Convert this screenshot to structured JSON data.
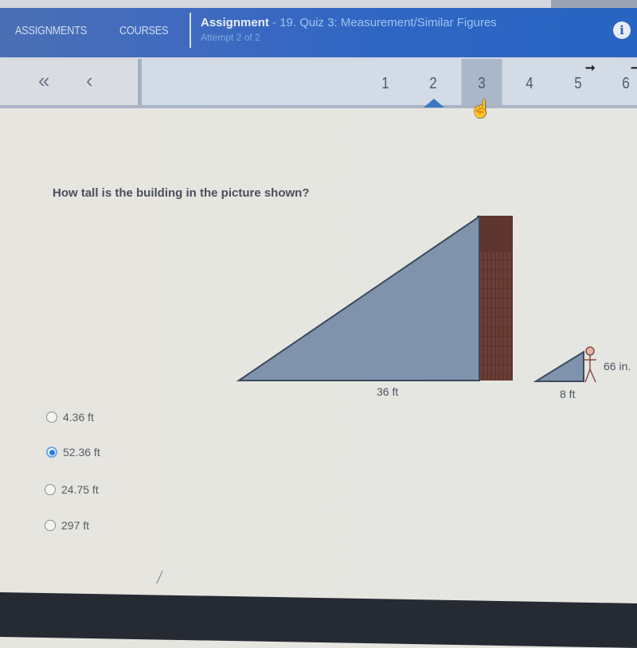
{
  "header": {
    "nav": [
      {
        "label": "ASSIGNMENTS"
      },
      {
        "label": "COURSES"
      }
    ],
    "title_strong": "Assignment",
    "title_rest": "  - 19. Quiz 3: Measurement/Similar Figures",
    "attempt": "Attempt 2 of 2",
    "info_glyph": "i"
  },
  "pager": {
    "first_glyph": "«",
    "prev_glyph": "‹",
    "pages": [
      "1",
      "2",
      "3",
      "4",
      "5",
      "6"
    ],
    "current_page": "2",
    "hovered_page": "3",
    "flag_glyph": "➞"
  },
  "question": {
    "text": "How tall is the building in the picture shown?",
    "diagram": {
      "building_shadow_label": "36 ft",
      "person_shadow_label": "8 ft",
      "person_height_label": "66 in."
    },
    "options": [
      {
        "label": "4.36 ft",
        "selected": false
      },
      {
        "label": "52.36 ft",
        "selected": true
      },
      {
        "label": "24.75 ft",
        "selected": false
      },
      {
        "label": "297 ft",
        "selected": false
      }
    ]
  },
  "colors": {
    "header_blue": "#2f66c4",
    "triangle_fill": "#7f93ad",
    "brick": "#6e3f36",
    "radio_selected": "#1a7ee6"
  }
}
